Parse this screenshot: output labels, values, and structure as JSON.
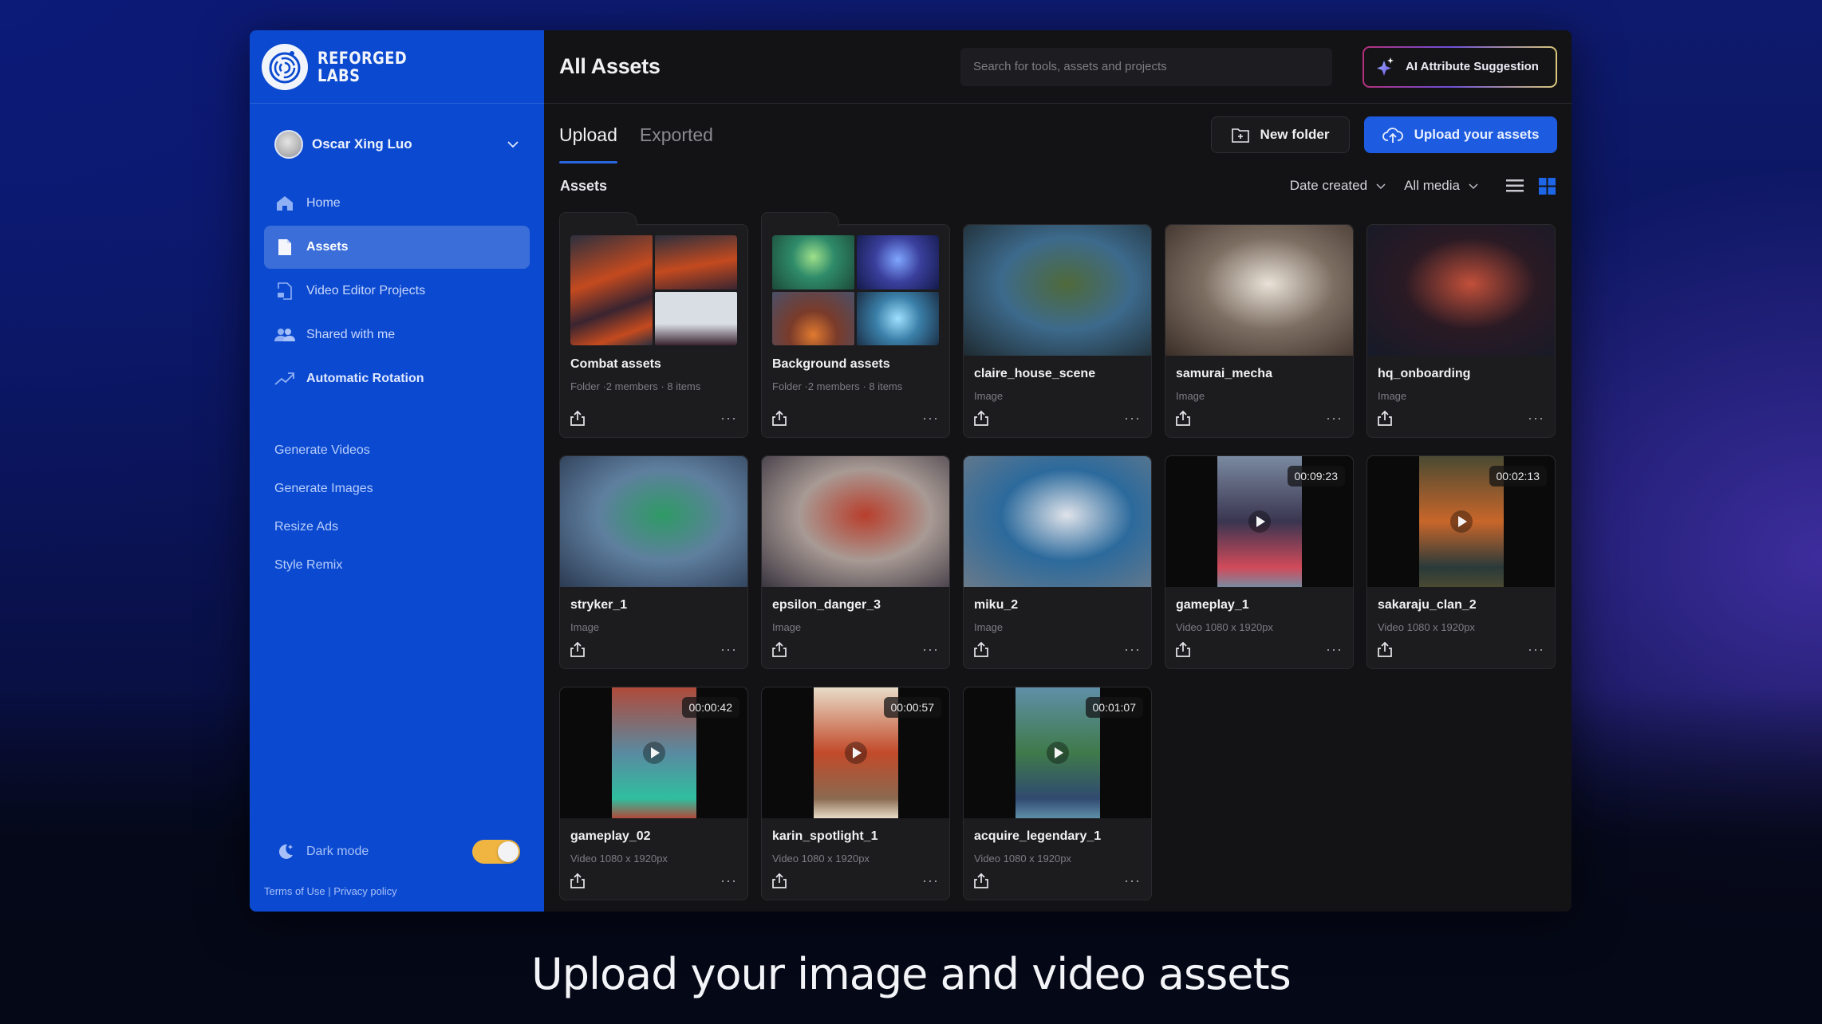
{
  "brand": {
    "line1": "REFORGED",
    "line2": "LABS"
  },
  "user": {
    "name": "Oscar Xing Luo"
  },
  "sidebar": {
    "nav": [
      {
        "label": "Home",
        "icon": "home-icon",
        "active": false
      },
      {
        "label": "Assets",
        "icon": "file-icon",
        "active": true
      },
      {
        "label": "Video Editor Projects",
        "icon": "video-file-icon",
        "active": false
      },
      {
        "label": "Shared with me",
        "icon": "users-icon",
        "active": false
      },
      {
        "label": "Automatic Rotation",
        "icon": "trending-up-icon",
        "active": false
      }
    ],
    "tools": [
      "Generate Videos",
      "Generate Images",
      "Resize Ads",
      "Style Remix"
    ],
    "dark_mode": {
      "label": "Dark mode",
      "enabled": true
    },
    "legal": {
      "terms": "Terms of Use",
      "separator": " | ",
      "privacy": "Privacy policy"
    }
  },
  "header": {
    "title": "All Assets",
    "search_placeholder": "Search for tools, assets and projects",
    "ai_button": "AI Attribute Suggestion"
  },
  "toolbar": {
    "tabs": [
      {
        "label": "Upload",
        "active": true
      },
      {
        "label": "Exported",
        "active": false
      }
    ],
    "new_folder": "New folder",
    "upload": "Upload your assets"
  },
  "filters": {
    "section_title": "Assets",
    "sort": "Date created",
    "media": "All media",
    "view": "grid"
  },
  "colors": {
    "sidebar": "#0b4ad0",
    "accent": "#1d5ce0",
    "toggle_on": "#f0b540",
    "main_bg": "#131315",
    "card_bg": "#1c1c1f"
  },
  "assets": [
    {
      "type": "folder",
      "title": "Combat assets",
      "meta": "Folder ·2 members · 8 items",
      "palette": [
        "#3a2430",
        "#c44a1f",
        "#2c2f3e",
        "#d9dde4"
      ]
    },
    {
      "type": "folder",
      "title": "Background assets",
      "meta": "Folder ·2 members · 8 items",
      "palette": [
        "#2f8b6a",
        "#3a3f9c",
        "#7a3b2a",
        "#3a7fa8"
      ]
    },
    {
      "type": "image",
      "title": "claire_house_scene",
      "meta": "Image",
      "palette": [
        "#3d6a8c",
        "#4f6a3a",
        "#1e2a30"
      ]
    },
    {
      "type": "image",
      "title": "samurai_mecha",
      "meta": "Image",
      "palette": [
        "#7d6e62",
        "#e9e2d8",
        "#3a2e28"
      ]
    },
    {
      "type": "image",
      "title": "hq_onboarding",
      "meta": "Image",
      "palette": [
        "#2a1a24",
        "#c2503a",
        "#151a28"
      ]
    },
    {
      "type": "image",
      "title": "stryker_1",
      "meta": "Image",
      "palette": [
        "#5f7f9f",
        "#2f9a66",
        "#2b3a52"
      ]
    },
    {
      "type": "image",
      "title": "epsilon_danger_3",
      "meta": "Image",
      "palette": [
        "#a89a94",
        "#b83e2c",
        "#3a3540"
      ]
    },
    {
      "type": "image",
      "title": "miku_2",
      "meta": "Image",
      "palette": [
        "#2c6a9c",
        "#dfe3ea",
        "#6a7a8a"
      ]
    },
    {
      "type": "video",
      "title": "gameplay_1",
      "meta": "Video 1080 x 1920px",
      "duration": "00:09:23",
      "palette": [
        "#7a8aa0",
        "#3a3550",
        "#d04a5a"
      ]
    },
    {
      "type": "video",
      "title": "sakaraju_clan_2",
      "meta": "Video 1080 x 1920px",
      "duration": "00:02:13",
      "palette": [
        "#4a4a32",
        "#c8662a",
        "#2a3a3a"
      ]
    },
    {
      "type": "video",
      "title": "gameplay_02",
      "meta": "Video 1080 x 1920px",
      "duration": "00:00:42",
      "palette": [
        "#b04a3a",
        "#5a8aa0",
        "#2fbfa0"
      ]
    },
    {
      "type": "video",
      "title": "karin_spotlight_1",
      "meta": "Video 1080 x 1920px",
      "duration": "00:00:57",
      "palette": [
        "#e8dcc8",
        "#c24a2a",
        "#8a6a50"
      ]
    },
    {
      "type": "video",
      "title": "acquire_legendary_1",
      "meta": "Video 1080 x 1920px",
      "duration": "00:01:07",
      "palette": [
        "#5f8fa8",
        "#3f7a4a",
        "#304a70"
      ]
    }
  ],
  "caption": "Upload your image and video assets"
}
